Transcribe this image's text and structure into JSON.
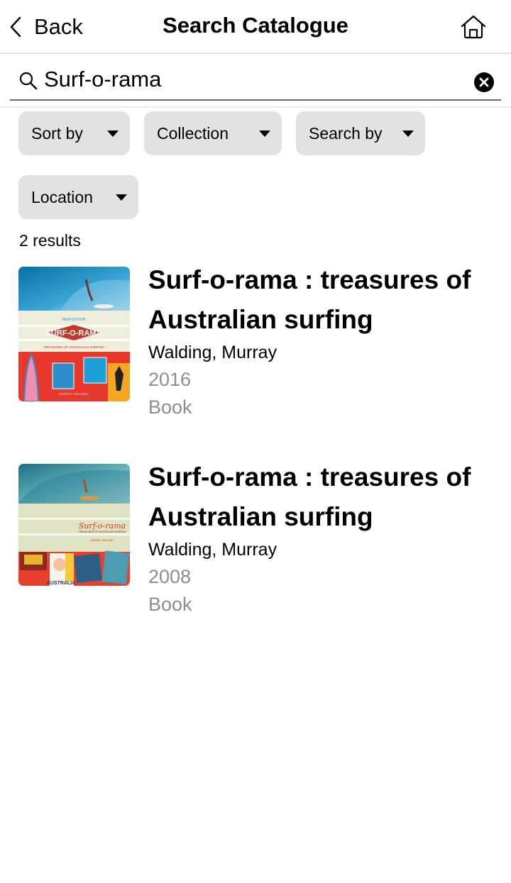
{
  "nav": {
    "back_label": "Back",
    "title": "Search Catalogue",
    "home_icon": "home-icon"
  },
  "search": {
    "value": "Surf-o-rama",
    "icon": "search-icon",
    "clear_icon": "clear-icon"
  },
  "filters": [
    {
      "label": "Sort by"
    },
    {
      "label": "Collection"
    },
    {
      "label": "Search by"
    },
    {
      "label": "Location"
    }
  ],
  "results_count": "2 results",
  "results": [
    {
      "title": "Surf-o-rama : treasures of Australian surfing",
      "author": "Walding, Murray",
      "year": "2016",
      "type": "Book",
      "cover": {
        "edition": "NEW EDITION",
        "logo": "SURF-O-RAMA",
        "subtitle": "TREASURES OF AUSTRALIAN SURFING",
        "author": "MURRAY WALDING"
      }
    },
    {
      "title": "Surf-o-rama : treasures of Australian surfing",
      "author": "Walding, Murray",
      "year": "2008",
      "type": "Book",
      "cover": {
        "logo": "Surf-o-rama",
        "subtitle": "TREASURES OF AUSTRALIAN SURFING",
        "author": "MURRAY WALDING",
        "poster": "AUSTRALIA"
      }
    }
  ]
}
